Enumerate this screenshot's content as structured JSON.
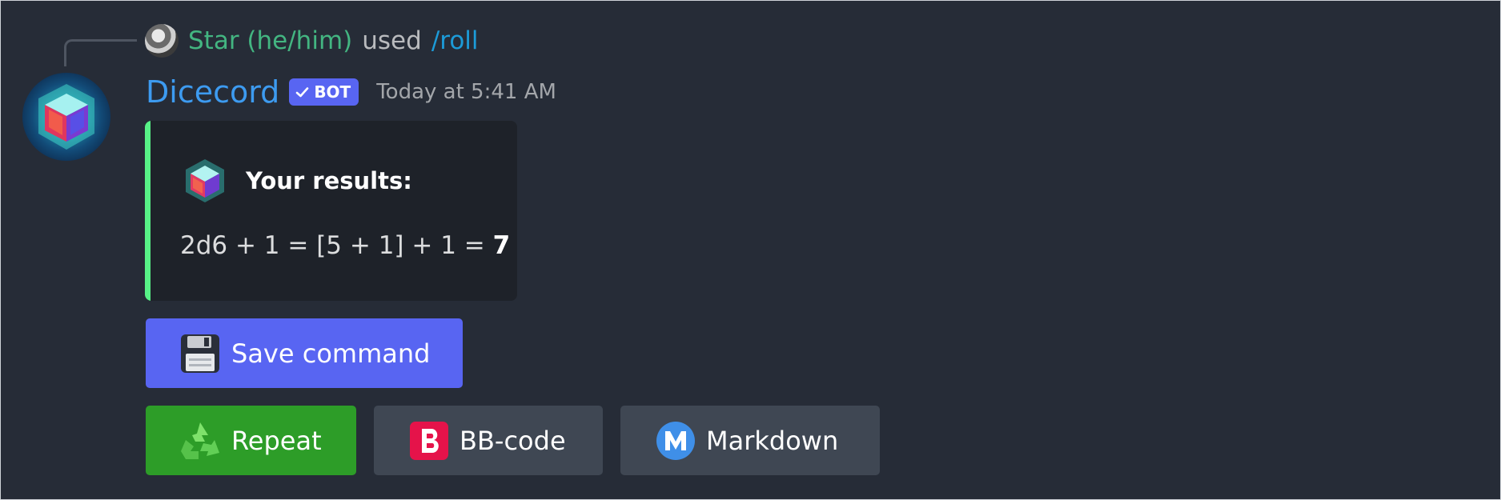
{
  "reply": {
    "user": "Star (he/him)",
    "used_text": "used",
    "command": "/roll"
  },
  "message": {
    "author": "Dicecord",
    "bot_tag": "BOT",
    "timestamp": "Today at 5:41 AM"
  },
  "embed": {
    "title": "Your results:",
    "expression_prefix": "2d6 + 1 = [5 + 1] + 1 = ",
    "result": "7",
    "accent_color": "#57f287"
  },
  "buttons": {
    "save_label": "Save command",
    "repeat_label": "Repeat",
    "bbcode_label": "BB-code",
    "markdown_label": "Markdown"
  },
  "icons": {
    "save": "floppy-disk-icon",
    "repeat": "recycle-icon",
    "bbcode": "b-letter-icon",
    "markdown": "m-letter-icon",
    "bot_verified": "checkmark-icon"
  }
}
